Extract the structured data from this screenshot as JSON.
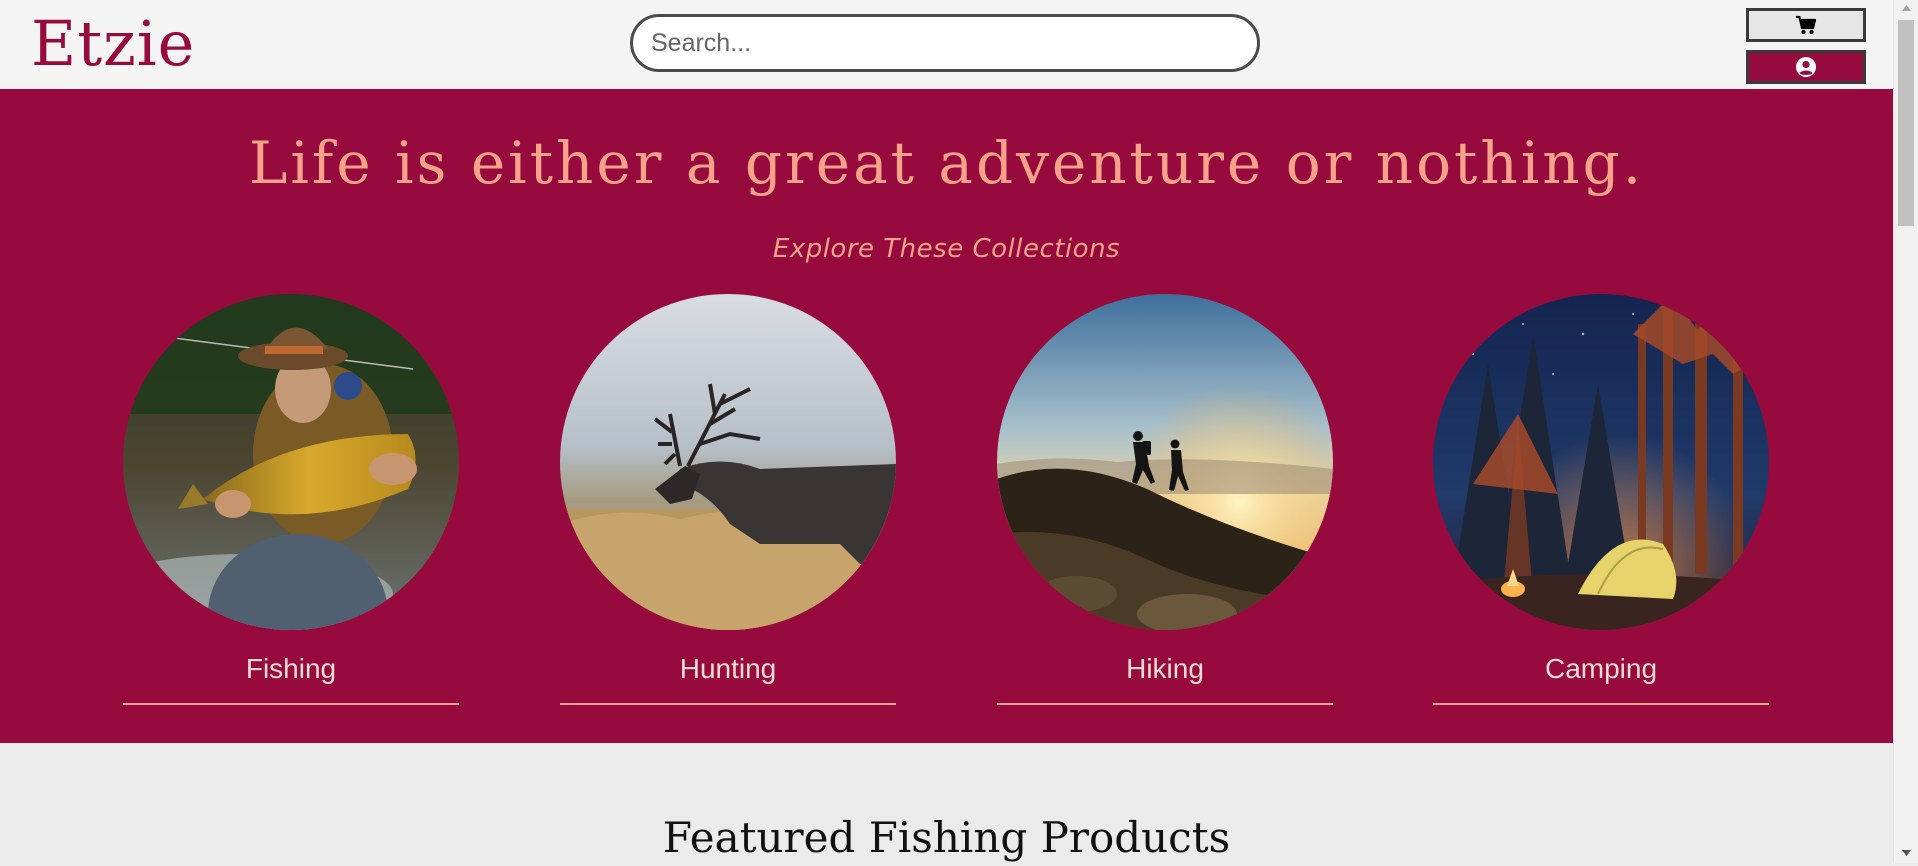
{
  "header": {
    "logo": "Etzie",
    "search": {
      "placeholder": "Search...",
      "value": ""
    },
    "cart_icon": "cart-icon",
    "account_icon": "user-circle-icon"
  },
  "hero": {
    "tagline": "Life is either a great adventure or nothing.",
    "subtitle": "Explore These Collections",
    "collections": [
      {
        "label": "Fishing",
        "image": "angler-holding-trout"
      },
      {
        "label": "Hunting",
        "image": "bugling-elk"
      },
      {
        "label": "Hiking",
        "image": "hikers-on-ridge-at-sunset"
      },
      {
        "label": "Camping",
        "image": "tent-under-starry-sky"
      }
    ]
  },
  "featured": {
    "title": "Featured Fishing Products"
  },
  "colors": {
    "brand": "#970a3d",
    "accent": "#f6a38a",
    "header_bg": "#f4f4f4",
    "page_bg": "#ebebeb"
  }
}
